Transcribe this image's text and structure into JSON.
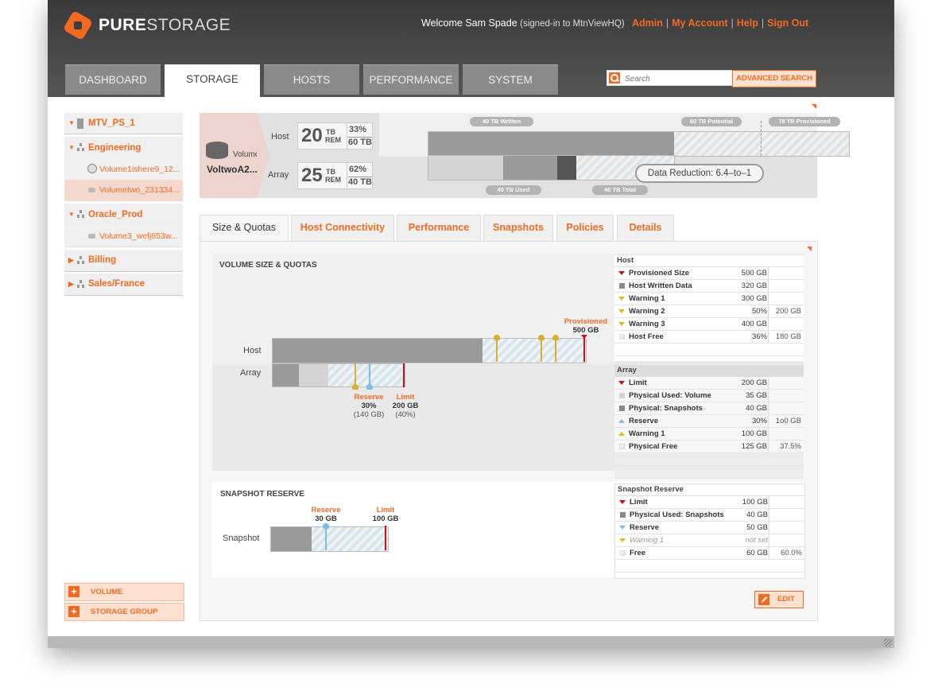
{
  "header": {
    "logo_bold": "PURE",
    "logo_light": "STORAGE",
    "welcome": "Welcome Sam Spade",
    "welcome_sub": "(signed-in to MtnViewHQ)",
    "links": [
      "Admin",
      "My Account",
      "Help",
      "Sign Out"
    ],
    "separator": "|",
    "tabs": [
      "DASHBOARD",
      "STORAGE",
      "HOSTS",
      "PERFORMANCE",
      "SYSTEM"
    ],
    "active_tab": "STORAGE",
    "search_placeholder": "Search",
    "advanced_search": "ADVANCED SEARCH"
  },
  "sidebar": {
    "array": "MTV_PS_1",
    "groups": [
      {
        "name": "Engineering",
        "volumes": [
          "Volume1ishere9_12...",
          "Volumetwo_231334..."
        ]
      },
      {
        "name": "Oracle_Prod",
        "volumes": [
          "Volume3_wefj853w..."
        ]
      },
      {
        "name": "Billing"
      },
      {
        "name": "Sales/France"
      }
    ],
    "add_volume": "VOLUME",
    "add_group": "STORAGE GROUP"
  },
  "summary": {
    "volume_label": "Volume",
    "volume_name": "VoltwoA2...",
    "host": {
      "label": "Host",
      "big": "20",
      "unit_top": "TB",
      "unit_bottom": "REM",
      "pct": "33%",
      "total": "60 TB"
    },
    "array": {
      "label": "Array",
      "big": "25",
      "unit_top": "TB",
      "unit_bottom": "REM",
      "pct": "62%",
      "total": "40 TB"
    },
    "pills": {
      "written": "40 TB Written",
      "potential": "60 TB Potential",
      "provisioned": "78 TB Provisioned",
      "used": "40 TB Used",
      "total": "40 TB Total"
    },
    "data_reduction": "Data Reduction: 6.4–to–1"
  },
  "tabs": [
    "Size & Quotas",
    "Host Connectivity",
    "Performance",
    "Snapshots",
    "Policies",
    "Details"
  ],
  "quotas": {
    "title": "VOLUME SIZE & QUOTAS",
    "host_label": "Host",
    "array_label": "Array",
    "provisioned_label": "Provisioned",
    "provisioned_value": "500 GB",
    "reserve_label": "Reserve",
    "reserve_pct": "30%",
    "reserve_size": "(140 GB)",
    "limit_label": "Limit",
    "limit_value": "200 GB",
    "limit_pct": "(40%)",
    "host_table": {
      "title": "Host",
      "rows": [
        {
          "name": "Provisioned Size",
          "value": "500 GB",
          "extra": ""
        },
        {
          "name": "Host Written Data",
          "value": "320 GB",
          "extra": ""
        },
        {
          "name": "Warning 1",
          "value": "300 GB",
          "extra": ""
        },
        {
          "name": "Warning 2",
          "value": "50%",
          "extra": "200 GB"
        },
        {
          "name": "Warning 3",
          "value": "400 GB",
          "extra": ""
        },
        {
          "name": "Host Free",
          "value": "36%",
          "extra": "180 GB"
        }
      ]
    },
    "array_table": {
      "title": "Array",
      "rows": [
        {
          "name": "Limit",
          "value": "200 GB",
          "extra": ""
        },
        {
          "name": "Physical Used: Volume",
          "value": "35 GB",
          "extra": ""
        },
        {
          "name": "Physical: Snapshots",
          "value": "40 GB",
          "extra": ""
        },
        {
          "name": "Reserve",
          "value": "30%",
          "extra": "1o0 GB"
        },
        {
          "name": "Warning 1",
          "value": "100 GB",
          "extra": ""
        },
        {
          "name": "Physical Free",
          "value": "125 GB",
          "extra": "37.5%"
        }
      ]
    }
  },
  "snapshot": {
    "title": "SNAPSHOT RESERVE",
    "row_label": "Snapshot",
    "reserve_label": "Reserve",
    "reserve_value": "30 GB",
    "limit_label": "Limit",
    "limit_value": "100 GB",
    "table": {
      "title": "Snapshot Reserve",
      "rows": [
        {
          "name": "Limit",
          "value": "100 GB",
          "extra": ""
        },
        {
          "name": "Physical Used: Snapshots",
          "value": "40 GB",
          "extra": ""
        },
        {
          "name": "Reserve",
          "value": "50 GB",
          "extra": ""
        },
        {
          "name": "Warning 1",
          "value": "not set",
          "extra": ""
        },
        {
          "name": "Free",
          "value": "60 GB",
          "extra": "60.0%"
        }
      ]
    }
  },
  "edit_label": "EDIT",
  "colors": {
    "accent": "#f26a21",
    "limit": "#c0141b",
    "warning": "#e8b420",
    "reserve": "#7bbfe0"
  }
}
